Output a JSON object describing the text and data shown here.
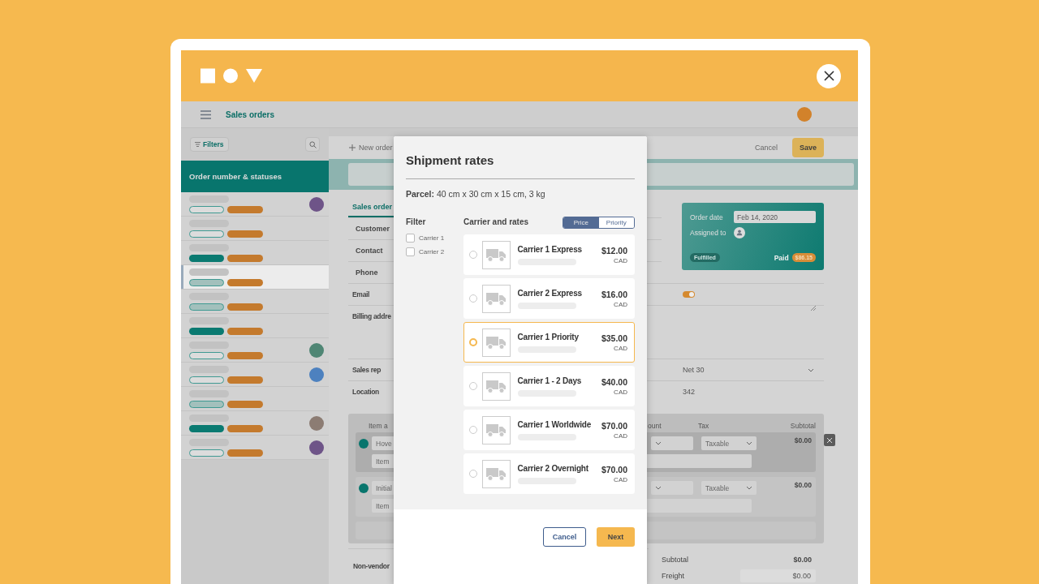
{
  "app_bar": {
    "title": "Sales orders"
  },
  "sidebar": {
    "filters": "Filters",
    "list_title": "Order number & statuses",
    "rows": [
      {
        "kind": "outline",
        "selected": false,
        "color": "#6e5488"
      },
      {
        "kind": "outline",
        "selected": false
      },
      {
        "kind": "filled",
        "selected": false
      },
      {
        "kind": "light",
        "selected": true
      },
      {
        "kind": "light",
        "selected": false
      },
      {
        "kind": "filled",
        "selected": false
      },
      {
        "kind": "outline",
        "selected": false,
        "color": "#4f8674"
      },
      {
        "kind": "outline",
        "selected": false,
        "color": "#4d81bf"
      },
      {
        "kind": "light",
        "selected": false
      },
      {
        "kind": "filled",
        "selected": false,
        "color": "#8c7c73"
      },
      {
        "kind": "outline",
        "selected": false,
        "color": "#6e5488"
      }
    ]
  },
  "toolbar": {
    "new_order": "New order",
    "cancel": "Cancel",
    "save": "Save"
  },
  "tabs": [
    {
      "label": "Sales order",
      "selected": true
    }
  ],
  "header_fields": [
    {
      "label": "Customer"
    },
    {
      "label": "Contact"
    },
    {
      "label": "Phone"
    }
  ],
  "order_card": {
    "order_date_label": "Order date",
    "order_date": "Feb 14, 2020",
    "assigned_label": "Assigned to",
    "status": "Fulfilled",
    "paid_label": "Paid",
    "paid_amount": "$86.15"
  },
  "fields": [
    {
      "label": "Email",
      "kind": "toggle",
      "on": true
    },
    {
      "label": "Billing addre",
      "kind": "textarea"
    },
    {
      "label": "Sales rep",
      "kind": "select",
      "value": "Net 30"
    },
    {
      "label": "Location",
      "kind": "text",
      "value": "342"
    }
  ],
  "items": {
    "columns": [
      "Item a",
      "ount",
      "Tax",
      "Subtotal"
    ],
    "rows": [
      {
        "name": "Hove",
        "description": "Item",
        "tax": "Taxable",
        "subtotal": "$0.00",
        "hovered": true
      },
      {
        "name": "Initial",
        "description": "Item",
        "tax": "Taxable",
        "subtotal": "$0.00",
        "hovered": false
      }
    ]
  },
  "totals": {
    "note": "Non-vendor",
    "rows": [
      {
        "label": "Subtotal",
        "value": "$0.00",
        "kind": "text"
      },
      {
        "label": "Freight",
        "value": "$0.00",
        "kind": "field"
      }
    ]
  },
  "modal": {
    "title": "Shipment rates",
    "parcel": "**Parcel:** 40 cm x 30 cm x 15 cm, 3 kg",
    "filter": {
      "title": "Filter",
      "options": [
        {
          "label": "Carrier 1",
          "checked": false
        },
        {
          "label": "Carrier 2",
          "checked": false
        }
      ]
    },
    "rates_title": "Carrier and rates",
    "sort": [
      {
        "label": "Price",
        "selected": true
      },
      {
        "label": "Priority",
        "selected": false
      }
    ],
    "rates": [
      {
        "name": "Carrier 1 Express",
        "price": "$12.00",
        "currency": "CAD",
        "selected": false
      },
      {
        "name": "Carrier 2 Express",
        "price": "$16.00",
        "currency": "CAD",
        "selected": false
      },
      {
        "name": "Carrier 1 Priority",
        "price": "$35.00",
        "currency": "CAD",
        "selected": true
      },
      {
        "name": "Carrier 1 - 2 Days",
        "price": "$40.00",
        "currency": "CAD",
        "selected": false
      },
      {
        "name": "Carrier 1 Worldwide",
        "price": "$70.00",
        "currency": "CAD",
        "selected": false
      },
      {
        "name": "Carrier 2 Overnight",
        "price": "$70.00",
        "currency": "CAD",
        "selected": false
      }
    ],
    "buttons": {
      "cancel": "Cancel",
      "next": "Next"
    }
  }
}
